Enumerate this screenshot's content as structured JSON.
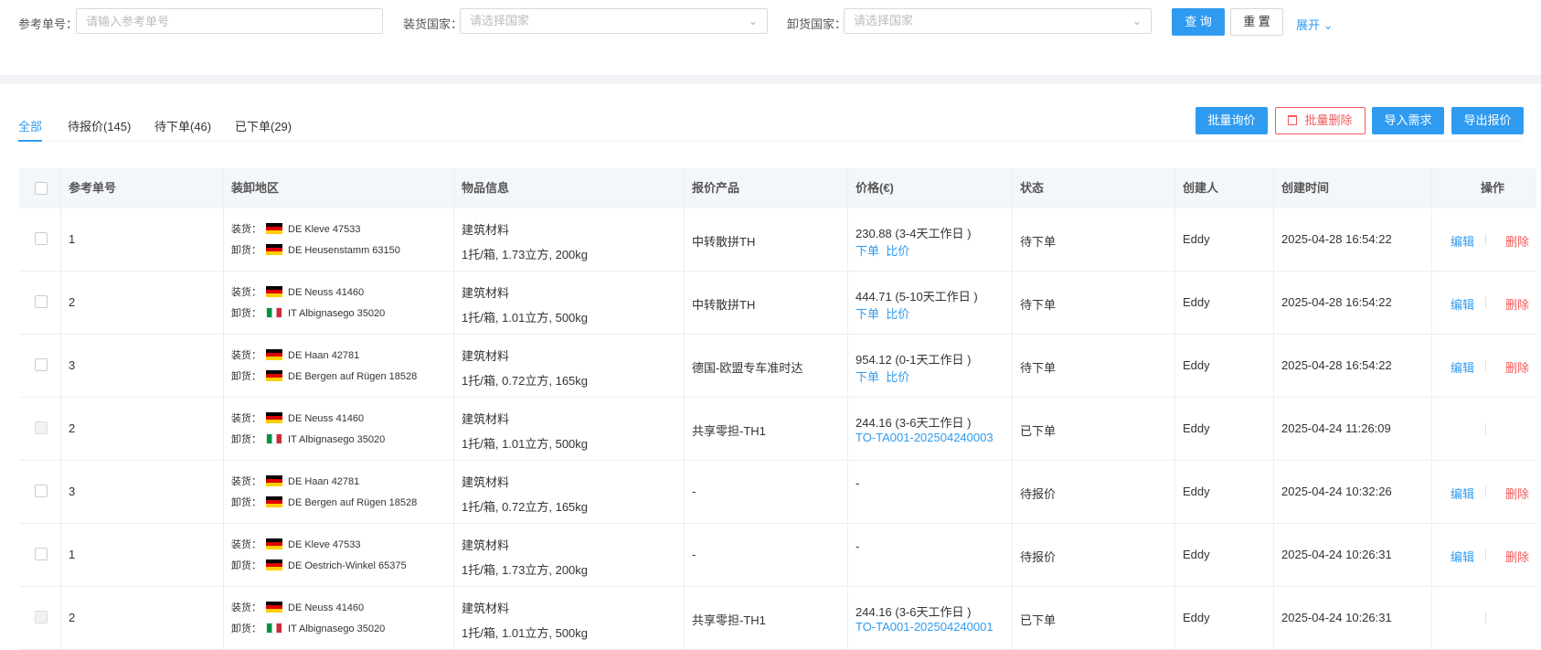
{
  "filters": {
    "ref_label": "参考单号：",
    "ref_placeholder": "请输入参考单号",
    "load_label": "装货国家：",
    "load_placeholder": "请选择国家",
    "unload_label": "卸货国家：",
    "unload_placeholder": "请选择国家",
    "query_button": "查 询",
    "reset_button": "重 置",
    "expand_link": "展开"
  },
  "tabs": [
    "全部",
    "待报价(145)",
    "待下单(46)",
    "已下单(29)"
  ],
  "active_tab": 0,
  "actions": {
    "batch_inquiry": "批量询价",
    "batch_delete": "批量删除",
    "import_demand": "导入需求",
    "export_quote": "导出报价"
  },
  "table": {
    "headers": [
      "参考单号",
      "装卸地区",
      "物品信息",
      "报价产品",
      "价格(€)",
      "状态",
      "创建人",
      "创建时间",
      "操作"
    ],
    "load_prefix": "装货：",
    "unload_prefix": "卸货：",
    "edit_label": "编辑",
    "delete_label": "删除",
    "order_label": "下单",
    "compare_label": "比价",
    "rows": [
      {
        "ref": "1",
        "load_flag": "de",
        "load": "DE Kleve 47533",
        "unload_flag": "de",
        "unload": "DE Heusenstamm 63150",
        "goods_name": "建筑材料",
        "goods_detail": "1托/箱, 1.73立方, 200kg",
        "product": "中转散拼TH",
        "price": "230.88 (3-4天工作日 )",
        "price_links": true,
        "order_no": "",
        "status": "待下单",
        "creator": "Eddy",
        "created": "2025-04-28 16:54:22",
        "ops": true,
        "disabled": false
      },
      {
        "ref": "2",
        "load_flag": "de",
        "load": "DE Neuss 41460",
        "unload_flag": "it",
        "unload": "IT Albignasego 35020",
        "goods_name": "建筑材料",
        "goods_detail": "1托/箱, 1.01立方, 500kg",
        "product": "中转散拼TH",
        "price": "444.71 (5-10天工作日 )",
        "price_links": true,
        "order_no": "",
        "status": "待下单",
        "creator": "Eddy",
        "created": "2025-04-28 16:54:22",
        "ops": true,
        "disabled": false
      },
      {
        "ref": "3",
        "load_flag": "de",
        "load": "DE Haan 42781",
        "unload_flag": "de",
        "unload": "DE Bergen auf Rügen 18528",
        "goods_name": "建筑材料",
        "goods_detail": "1托/箱, 0.72立方, 165kg",
        "product": "德国-欧盟专车准时达",
        "price": "954.12 (0-1天工作日 )",
        "price_links": true,
        "order_no": "",
        "status": "待下单",
        "creator": "Eddy",
        "created": "2025-04-28 16:54:22",
        "ops": true,
        "disabled": false
      },
      {
        "ref": "2",
        "load_flag": "de",
        "load": "DE Neuss 41460",
        "unload_flag": "it",
        "unload": "IT Albignasego 35020",
        "goods_name": "建筑材料",
        "goods_detail": "1托/箱, 1.01立方, 500kg",
        "product": "共享零担-TH1",
        "price": "244.16 (3-6天工作日 )",
        "price_links": false,
        "order_no": "TO-TA001-202504240003",
        "status": "已下单",
        "creator": "Eddy",
        "created": "2025-04-24 11:26:09",
        "ops": false,
        "disabled": true
      },
      {
        "ref": "3",
        "load_flag": "de",
        "load": "DE Haan 42781",
        "unload_flag": "de",
        "unload": "DE Bergen auf Rügen 18528",
        "goods_name": "建筑材料",
        "goods_detail": "1托/箱, 0.72立方, 165kg",
        "product": "-",
        "price": "-",
        "price_links": false,
        "order_no": "",
        "status": "待报价",
        "creator": "Eddy",
        "created": "2025-04-24 10:32:26",
        "ops": true,
        "disabled": false
      },
      {
        "ref": "1",
        "load_flag": "de",
        "load": "DE Kleve 47533",
        "unload_flag": "de",
        "unload": "DE Oestrich-Winkel 65375",
        "goods_name": "建筑材料",
        "goods_detail": "1托/箱, 1.73立方, 200kg",
        "product": "-",
        "price": "-",
        "price_links": false,
        "order_no": "",
        "status": "待报价",
        "creator": "Eddy",
        "created": "2025-04-24 10:26:31",
        "ops": true,
        "disabled": false
      },
      {
        "ref": "2",
        "load_flag": "de",
        "load": "DE Neuss 41460",
        "unload_flag": "it",
        "unload": "IT Albignasego 35020",
        "goods_name": "建筑材料",
        "goods_detail": "1托/箱, 1.01立方, 500kg",
        "product": "共享零担-TH1",
        "price": "244.16 (3-6天工作日 )",
        "price_links": false,
        "order_no": "TO-TA001-202504240001",
        "status": "已下单",
        "creator": "Eddy",
        "created": "2025-04-24 10:26:31",
        "ops": false,
        "disabled": true
      }
    ]
  }
}
